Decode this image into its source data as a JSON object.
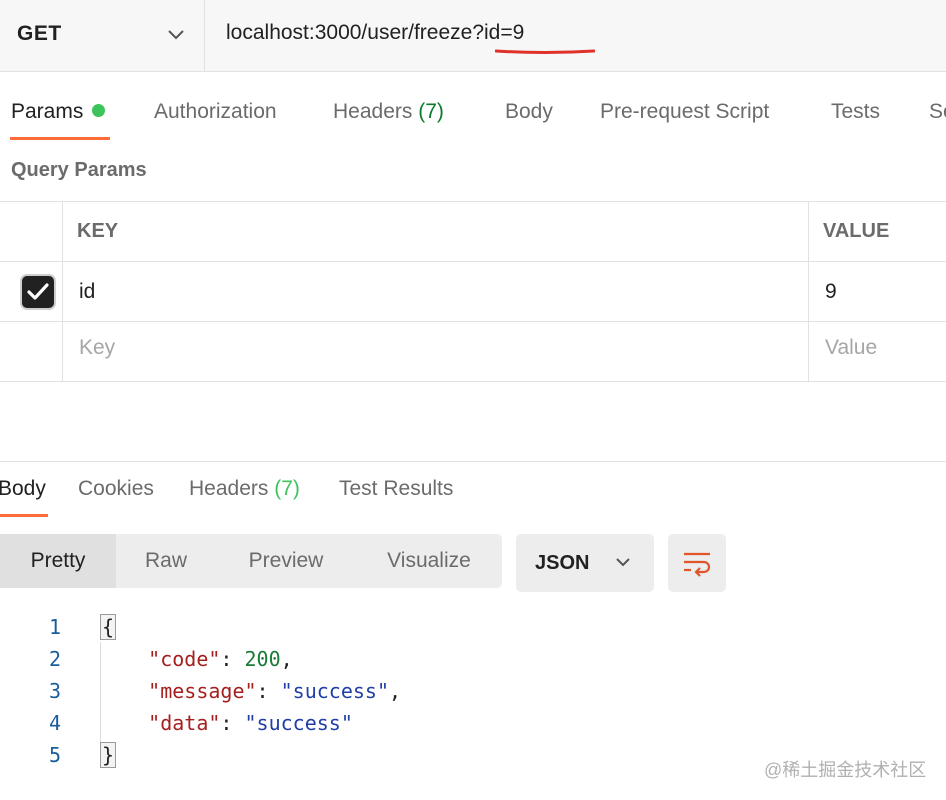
{
  "request": {
    "method": "GET",
    "url": "localhost:3000/user/freeze?id=9"
  },
  "request_tabs": [
    {
      "label": "Params",
      "active": true,
      "dot": true
    },
    {
      "label": "Authorization"
    },
    {
      "label": "Headers",
      "count": "(7)"
    },
    {
      "label": "Body"
    },
    {
      "label": "Pre-request Script"
    },
    {
      "label": "Tests"
    },
    {
      "label": "Se"
    }
  ],
  "query_params": {
    "title": "Query Params",
    "headers": {
      "key": "KEY",
      "value": "VALUE"
    },
    "rows": [
      {
        "checked": true,
        "key": "id",
        "value": "9"
      }
    ],
    "placeholder_key": "Key",
    "placeholder_value": "Value"
  },
  "response_tabs": [
    {
      "label": "Body",
      "active": true
    },
    {
      "label": "Cookies"
    },
    {
      "label": "Headers",
      "count": "(7)"
    },
    {
      "label": "Test Results"
    }
  ],
  "view_modes": [
    {
      "label": "Pretty",
      "active": true
    },
    {
      "label": "Raw"
    },
    {
      "label": "Preview"
    },
    {
      "label": "Visualize"
    }
  ],
  "format": "JSON",
  "code_lines": [
    {
      "n": "1",
      "text": "{"
    },
    {
      "n": "2",
      "key": "\"code\"",
      "value": "200",
      "type": "number",
      "comma": true
    },
    {
      "n": "3",
      "key": "\"message\"",
      "value": "\"success\"",
      "type": "string",
      "comma": true
    },
    {
      "n": "4",
      "key": "\"data\"",
      "value": "\"success\"",
      "type": "string",
      "comma": false
    },
    {
      "n": "5",
      "text": "}"
    }
  ],
  "watermark": "@稀土掘金技术社区",
  "colors": {
    "accent": "#ff6c37",
    "green": "#3cc35b",
    "key": "#a61f1f",
    "string": "#1f3fa6",
    "number": "#1a7a39"
  },
  "icons": [
    "chevron-down-icon",
    "checkmark-icon",
    "wrap-lines-icon"
  ]
}
